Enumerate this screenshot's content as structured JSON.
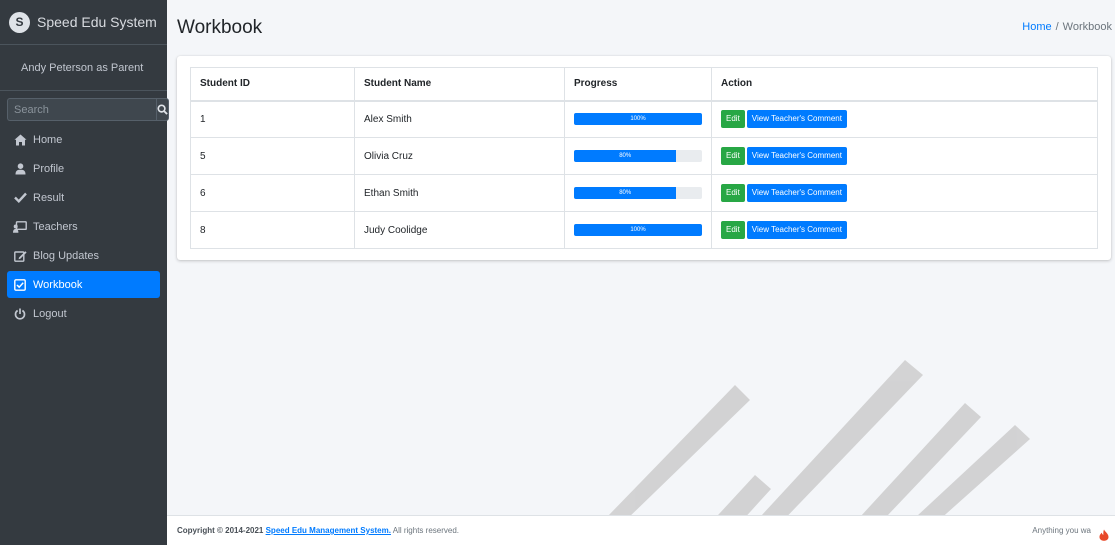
{
  "app": {
    "brand_name": "Speed Edu System",
    "brand_logo_letter": "S",
    "user_label": "Andy Peterson as Parent"
  },
  "search": {
    "placeholder": "Search",
    "icon": "search-icon"
  },
  "sidebar": {
    "items": [
      {
        "label": "Home",
        "icon": "home-icon"
      },
      {
        "label": "Profile",
        "icon": "user-icon"
      },
      {
        "label": "Result",
        "icon": "check-icon"
      },
      {
        "label": "Teachers",
        "icon": "chalkboard-teacher-icon"
      },
      {
        "label": "Blog Updates",
        "icon": "edit-icon"
      },
      {
        "label": "Workbook",
        "icon": "checkbox-icon",
        "active": true
      },
      {
        "label": "Logout",
        "icon": "power-icon"
      }
    ]
  },
  "header": {
    "title": "Workbook",
    "breadcrumb_home": "Home",
    "breadcrumb_separator": "/",
    "breadcrumb_current": "Workbook"
  },
  "table": {
    "columns": [
      "Student ID",
      "Student Name",
      "Progress",
      "Action"
    ],
    "rows": [
      {
        "id": "1",
        "name": "Alex Smith",
        "progress": 100,
        "progress_label": "100%",
        "edit_label": "Edit",
        "view_label": "View Teacher's Comment"
      },
      {
        "id": "5",
        "name": "Olivia Cruz",
        "progress": 80,
        "progress_label": "80%",
        "edit_label": "Edit",
        "view_label": "View Teacher's Comment"
      },
      {
        "id": "6",
        "name": "Ethan Smith",
        "progress": 80,
        "progress_label": "80%",
        "edit_label": "Edit",
        "view_label": "View Teacher's Comment"
      },
      {
        "id": "8",
        "name": "Judy Coolidge",
        "progress": 100,
        "progress_label": "100%",
        "edit_label": "Edit",
        "view_label": "View Teacher's Comment"
      }
    ]
  },
  "footer": {
    "copyright_prefix": "Copyright © 2014-2021 ",
    "copyright_brand": "Speed Edu Management System.",
    "copyright_suffix": " All rights reserved.",
    "right_text": "Anything you wa",
    "right_icon": "flame-icon"
  },
  "colors": {
    "sidebar_bg": "#343a40",
    "accent": "#007bff",
    "edit_button": "#28a745",
    "page_bg": "#f4f6f9"
  }
}
